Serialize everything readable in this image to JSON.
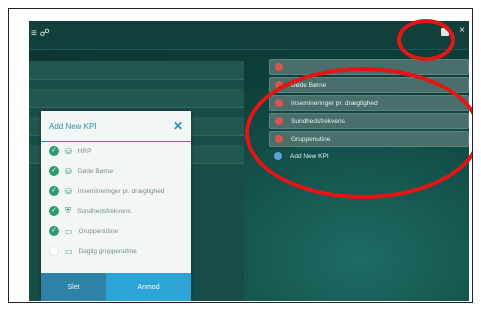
{
  "app": {
    "logo_text": "≡ ☍"
  },
  "top_controls": {
    "save_icon": "save-icon",
    "close_symbol": "×"
  },
  "kpi_list": [
    {
      "label": "",
      "color": "red"
    },
    {
      "label": "Døde Børne",
      "color": "red"
    },
    {
      "label": "Insemineringer pr. drægtighed",
      "color": "red"
    },
    {
      "label": "Sundhedsfrekvens",
      "color": "red"
    },
    {
      "label": "Gruppenutine",
      "color": "red"
    },
    {
      "label": "Add New KPI",
      "color": "blue"
    }
  ],
  "modal": {
    "title": "Add New KPI",
    "close_symbol": "✕",
    "options": [
      {
        "label": "HRP",
        "checked": true
      },
      {
        "label": "Døde Børne",
        "checked": true
      },
      {
        "label": "Insemineringer pr. drægtighed",
        "checked": true
      },
      {
        "label": "Sundhedsfrekvens",
        "checked": true
      },
      {
        "label": "Gruppenutine",
        "checked": true
      },
      {
        "label": "Daglig gruppenutine",
        "checked": false
      }
    ],
    "back_label": "Slet",
    "apply_label": "Anmod"
  }
}
